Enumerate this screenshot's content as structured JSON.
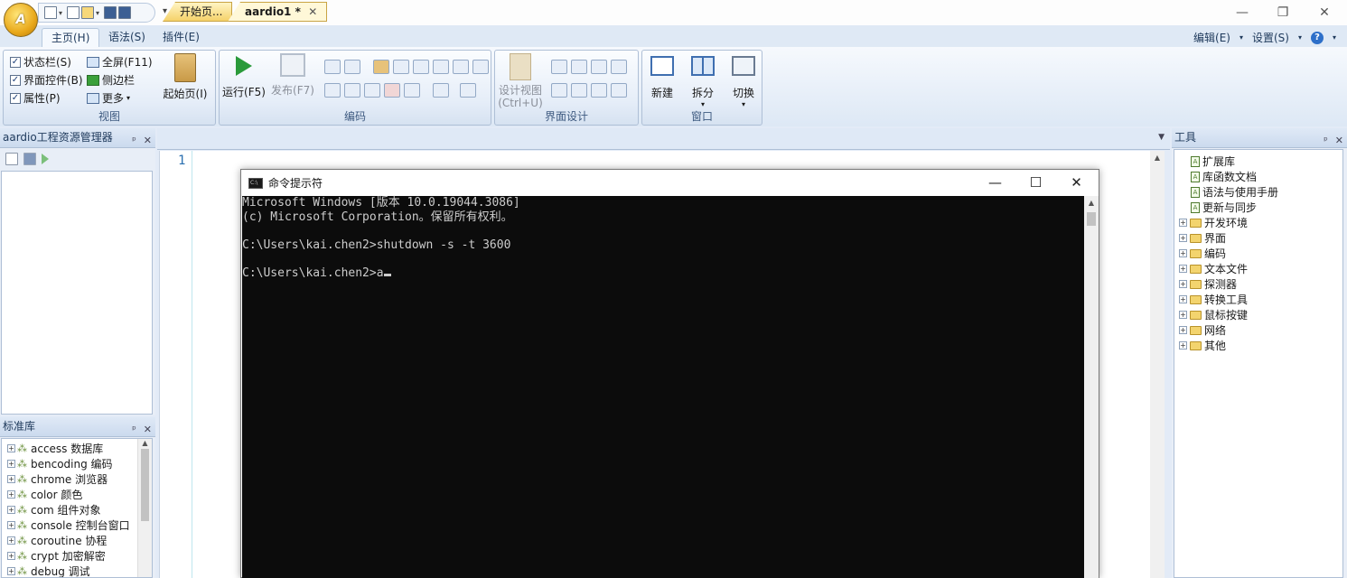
{
  "app": {
    "logo_letter": "A",
    "window_controls": {
      "minimize": "—",
      "restore": "❐",
      "close": "✕"
    },
    "qat_more": "▾"
  },
  "ribbon": {
    "tabs": [
      "主页(H)",
      "语法(S)",
      "插件(E)"
    ],
    "active_tab": "主页(H)",
    "right_menu": {
      "edit": "编辑(E)",
      "settings": "设置(S)",
      "help": "?"
    },
    "view_group": {
      "caption": "视图",
      "status_bar": "状态栏(S)",
      "ui_controls": "界面控件(B)",
      "properties": "属性(P)",
      "fullscreen": "全屏(F11)",
      "sidebar": "侧边栏",
      "more": "更多",
      "start_page": "起始页(I)"
    },
    "code_group": {
      "caption": "编码",
      "run": "运行(F5)",
      "publish": "发布(F7)"
    },
    "ui_group": {
      "caption": "界面设计",
      "design_view": "设计视图",
      "design_shortcut": "(Ctrl+U)"
    },
    "window_group": {
      "caption": "窗口",
      "new": "新建",
      "split": "拆分",
      "switch": "切换"
    }
  },
  "project_panel": {
    "title": "aardio工程资源管理器",
    "pin": "ᵖ",
    "close": "✕"
  },
  "library_panel": {
    "title": "标准库",
    "items": [
      "access 数据库",
      "bencoding 编码",
      "chrome 浏览器",
      "color 颜色",
      "com 组件对象",
      "console 控制台窗口",
      "coroutine 协程",
      "crypt 加密解密",
      "debug 调试"
    ]
  },
  "editor": {
    "tabs": [
      {
        "label": "开始页..."
      },
      {
        "label": "aardio1 *",
        "close": "✕"
      }
    ],
    "line_number": "1"
  },
  "tools_panel": {
    "title": "工具",
    "docs": [
      "扩展库",
      "库函数文档",
      "语法与使用手册",
      "更新与同步"
    ],
    "folders": [
      "开发环境",
      "界面",
      "编码",
      "文本文件",
      "探测器",
      "转换工具",
      "鼠标按键",
      "网络",
      "其他"
    ]
  },
  "cmd_window": {
    "title": "命令提示符",
    "controls": {
      "minimize": "—",
      "maximize": "☐",
      "close": "✕"
    },
    "lines": [
      "Microsoft Windows [版本 10.0.19044.3086]",
      "(c) Microsoft Corporation。保留所有权利。",
      "",
      "C:\\Users\\kai.chen2>shutdown -s -t 3600",
      "",
      "C:\\Users\\kai.chen2>a"
    ]
  }
}
